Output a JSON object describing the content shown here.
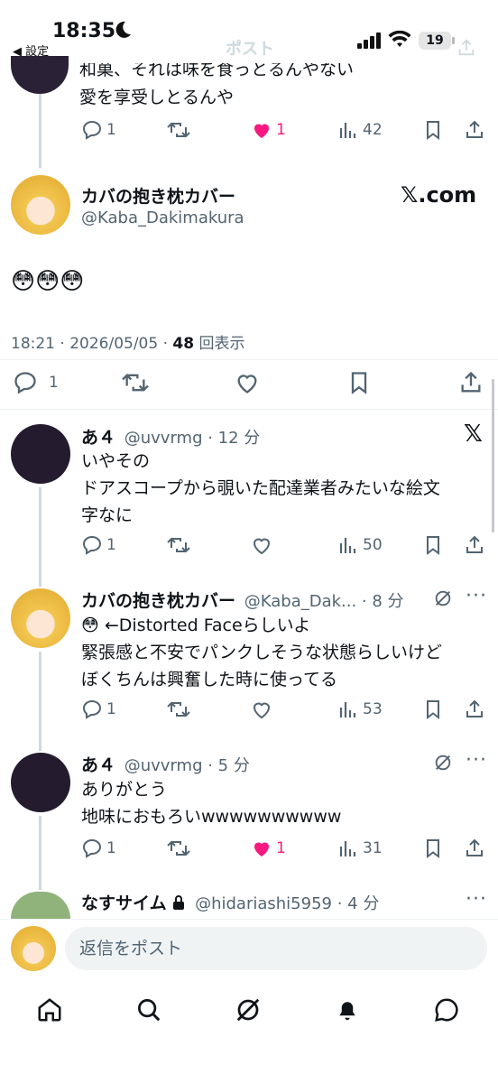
{
  "status_bar": {
    "time": "18:35",
    "back_label": "◀ 設定",
    "battery": "19"
  },
  "header": {
    "title": "ポスト"
  },
  "prev_tweet": {
    "line1": "和菓、それは味を食っとるんやない",
    "line2": "愛を享受しとるんや",
    "replies": "1",
    "likes": "1",
    "views": "42"
  },
  "main_tweet": {
    "name": "カバの抱き枕カバー",
    "handle": "@Kaba_Dakimakura",
    "badge": "𝕏.com",
    "emoji": "😳😳😳",
    "time_date": "18:21 · 2026/05/05 · ",
    "views_count": "48",
    "views_label": " 回表示",
    "replies": "1"
  },
  "replies": [
    {
      "name": "あ４",
      "meta": "@uvvrmg · 12 分",
      "lines": [
        "いやその",
        "ドアスコープから覗いた配達業者みたいな絵文",
        "字なに"
      ],
      "replies": "1",
      "likes": "",
      "views": "50"
    },
    {
      "name": "カバの抱き枕カバー",
      "meta": "@Kaba_Dak... · 8 分",
      "lines": [
        "😳 ←Distorted Faceらしいよ",
        "緊張感と不安でパンクしそうな状態らしいけど",
        "ぼくちんは興奮した時に使ってる"
      ],
      "replies": "1",
      "likes": "",
      "views": "53"
    },
    {
      "name": "あ４",
      "meta": "@uvvrmg · 5 分",
      "lines": [
        "ありがとう",
        "地味におもろいwwwwwwwwww"
      ],
      "replies": "1",
      "likes": "1",
      "views": "31"
    },
    {
      "name": "なすサイム",
      "meta": "@hidariashi5959 · 4 分"
    }
  ],
  "composer": {
    "placeholder": "返信をポスト"
  },
  "colors": {
    "like": "#f91880",
    "icon_gray": "#536471",
    "divider": "#eff3f4"
  }
}
